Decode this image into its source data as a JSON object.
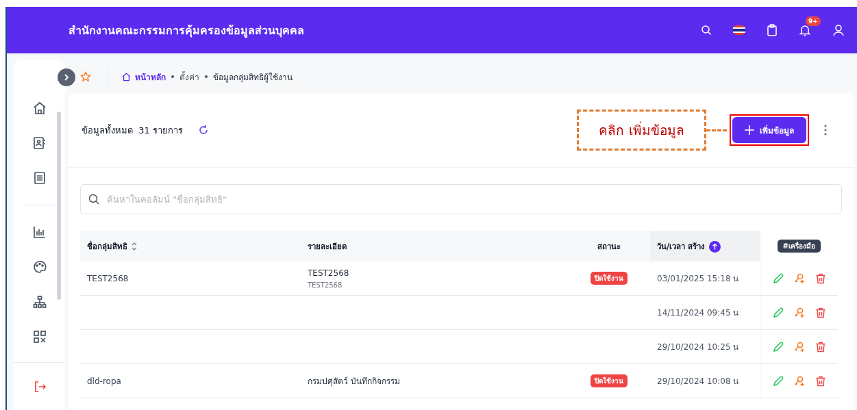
{
  "header": {
    "title": "สำนักงานคณะกรรมการคุ้มครองข้อมูลส่วนบุคคล",
    "notification_count": "9+"
  },
  "breadcrumb": [
    {
      "label": "หน้าหลัก",
      "kind": "home"
    },
    {
      "label": "ตั้งค่า",
      "kind": "link"
    },
    {
      "label": "ข้อมูลกลุ่มสิทธิผู้ใช้งาน",
      "kind": "current"
    }
  ],
  "toolbar": {
    "total": "ข้อมูลทั้งหมด  31 รายการ",
    "add_button": "เพิ่มข้อมูล"
  },
  "annotation": {
    "text": "คลิก เพิ่มข้อมูล"
  },
  "search": {
    "placeholder": "ค้นหาในคอลัมน์ \"ชื่อกลุ่มสิทธิ\""
  },
  "table": {
    "columns": [
      "ชื่อกลุ่มสิทธิ",
      "รายละเอียด",
      "สถานะ",
      "วัน/เวลา สร้าง"
    ],
    "tools_label": "#เครื่องมือ",
    "rows": [
      {
        "name": "TEST2568",
        "detail": "TEST2568",
        "detail_sub": "TEST2568",
        "status": "ปิดใช้งาน",
        "created": "03/01/2025 15:18 น"
      },
      {
        "created": "14/11/2024 09:45 น"
      },
      {
        "created": "29/10/2024 10:25 น"
      },
      {
        "name": "dld-ropa",
        "detail": "กรมปศุสัตว์ บันทึกกิจกรรม",
        "status": "ปิดใช้งาน",
        "created": "29/10/2024 10:08 น"
      }
    ]
  }
}
